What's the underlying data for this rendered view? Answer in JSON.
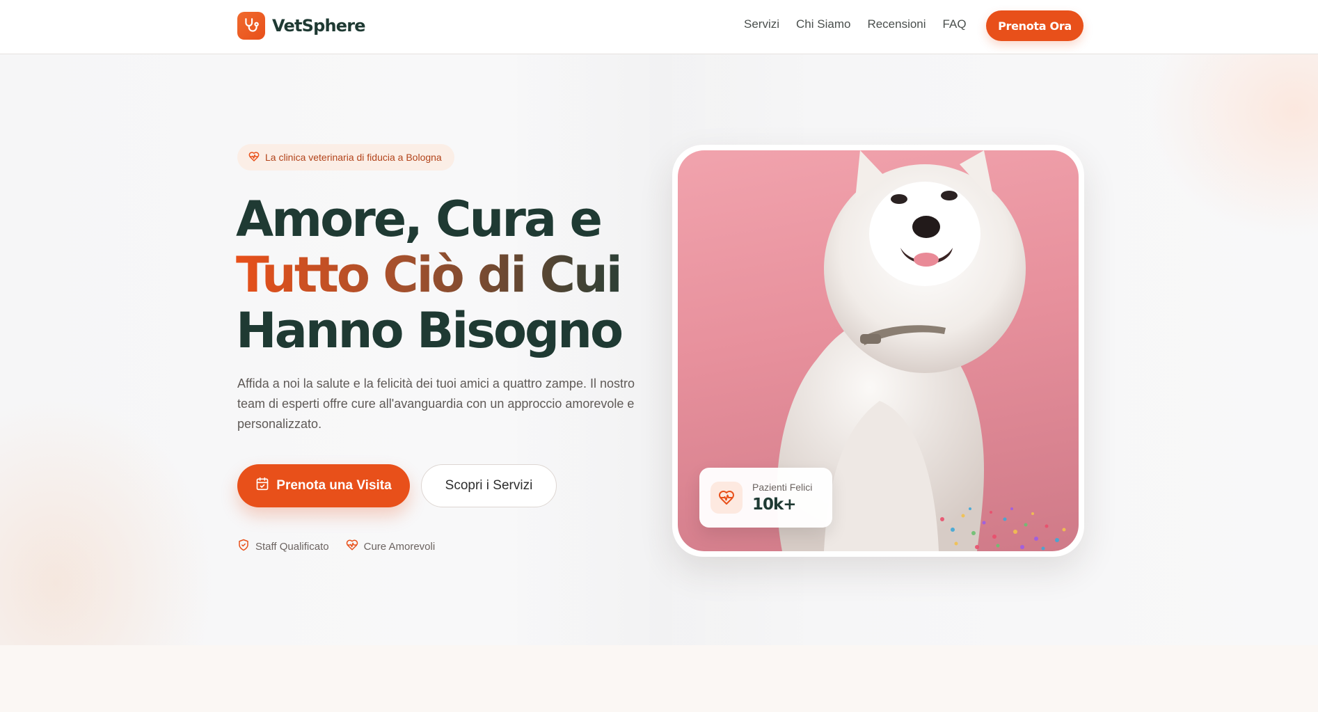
{
  "brand": {
    "name": "VetSphere",
    "accent": "#e8501a",
    "dark": "#1f3a33"
  },
  "nav": {
    "items": [
      "Servizi",
      "Chi Siamo",
      "Recensioni",
      "FAQ"
    ],
    "cta": "Prenota Ora"
  },
  "hero": {
    "badge": "La clinica veterinaria di fiducia a Bologna",
    "headline": {
      "line1": "Amore, Cura e",
      "line2": "Tutto Ciò di Cui",
      "line3": "Hanno Bisogno"
    },
    "subtitle": "Affida a noi la salute e la felicità dei tuoi amici a quattro zampe. Il nostro team di esperti offre cure all'avanguardia con un approccio amorevole e personalizzato.",
    "primary_button": "Prenota una Visita",
    "secondary_button": "Scopri i Servizi",
    "features": [
      "Staff Qualificato",
      "Cure Amorevoli"
    ]
  },
  "stat": {
    "label": "Pazienti Felici",
    "value": "10k+"
  },
  "icons": {
    "logo": "stethoscope-icon",
    "badge": "heart-pulse-icon",
    "primary_button": "calendar-icon",
    "feature_1": "shield-check-icon",
    "feature_2": "heart-pulse-icon",
    "stat": "heart-pulse-icon"
  }
}
